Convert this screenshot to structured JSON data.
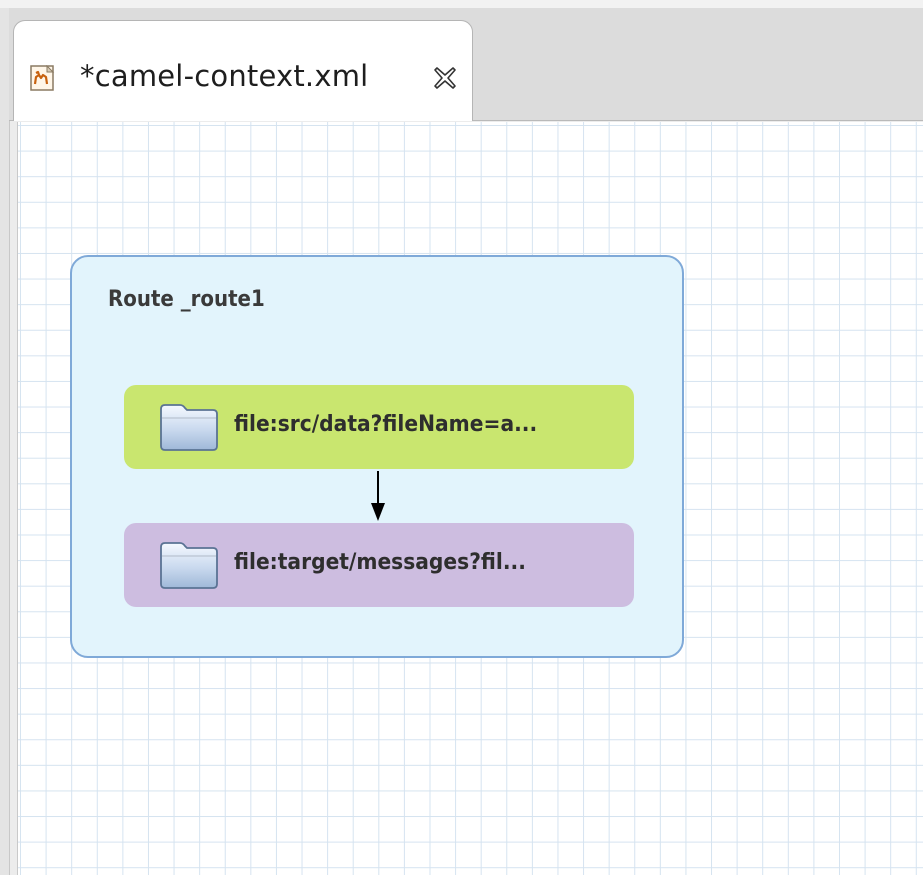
{
  "editor": {
    "tab": {
      "title": "*camel-context.xml",
      "icon": "camel-file-icon",
      "close_icon": "close-icon"
    }
  },
  "diagram": {
    "route": {
      "label": "Route _route1",
      "color": "#e2f4fc",
      "border_color": "#7fa9d8"
    },
    "nodes": [
      {
        "label": "file:src/data?fileName=a...",
        "icon": "folder-icon",
        "color": "#c9e66f"
      },
      {
        "label": "file:target/messages?fil...",
        "icon": "folder-icon",
        "color": "#cdbde0"
      }
    ],
    "connection": {
      "icon": "arrow-down-icon"
    }
  }
}
